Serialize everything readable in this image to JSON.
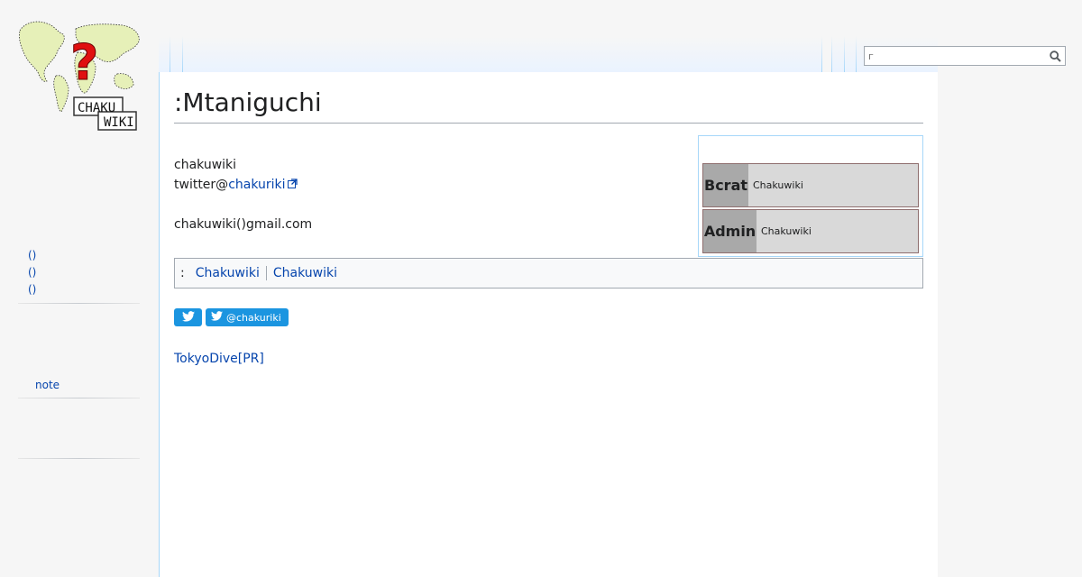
{
  "site": {
    "logo_text_line1": "CHAKU",
    "logo_text_line2": "WIKI"
  },
  "search": {
    "value": "",
    "placeholder": "г",
    "icon": "search-icon"
  },
  "page": {
    "title": ":Mtaniguchi",
    "line1": "chakuwiki",
    "twitter_prefix": "twitter@",
    "twitter_link": "chakuriki",
    "email": "chakuwiki()gmail.com"
  },
  "userboxes": [
    {
      "code": "Bcrat",
      "info": "Chakuwiki"
    },
    {
      "code": "Admin",
      "info": "Chakuwiki"
    }
  ],
  "categories": {
    "prefix": ":",
    "items": [
      "Chakuwiki",
      "Chakuwiki"
    ]
  },
  "twitter_buttons": {
    "tweet_icon": "twitter-bird-icon",
    "follow_label": "@chakuriki"
  },
  "promo": {
    "label": "TokyoDive[PR]"
  },
  "sidebar": {
    "items": [
      "()",
      "()",
      "()"
    ],
    "note_label": "note"
  },
  "colors": {
    "link": "#0645ad",
    "twitter_blue": "#1b95e0",
    "border_blue": "#a7d7f9"
  }
}
